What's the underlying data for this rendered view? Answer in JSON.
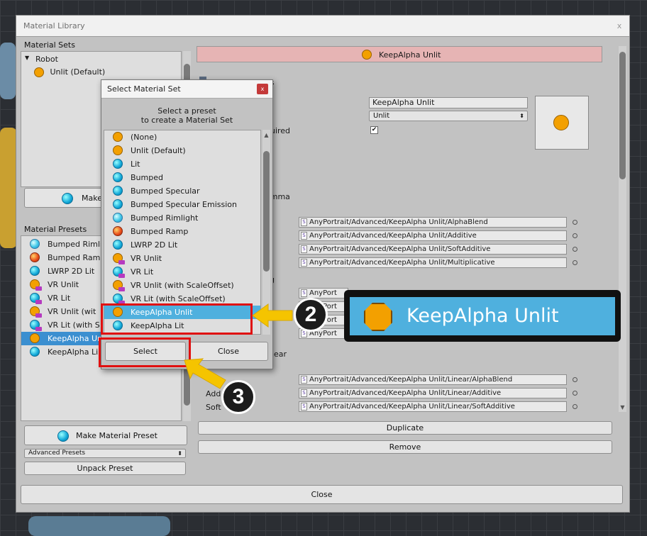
{
  "window": {
    "title": "Material Library",
    "close_glyph": "x"
  },
  "material_sets": {
    "heading": "Material Sets",
    "root": "Robot",
    "items": [
      {
        "label": "Unlit (Default)",
        "icon": "orange-circle-icon"
      }
    ],
    "make_button": "Make"
  },
  "material_presets": {
    "heading": "Material Presets",
    "items": [
      {
        "label": "Bumped Rimli",
        "icon": "rim-icon"
      },
      {
        "label": "Bumped Ramp",
        "icon": "ramp-icon"
      },
      {
        "label": "LWRP 2D Lit",
        "icon": "cyan-circle-icon"
      },
      {
        "label": "VR Unlit",
        "icon": "orange-vr-icon"
      },
      {
        "label": "VR Lit",
        "icon": "cyan-vr-icon"
      },
      {
        "label": "VR Unlit (wit",
        "icon": "orange-vr-icon"
      },
      {
        "label": "VR Lit (with S",
        "icon": "cyan-vr-icon"
      },
      {
        "label": "KeepAlpha Un",
        "icon": "orange-circle-icon",
        "selected": true
      },
      {
        "label": "KeepAlpha Li",
        "icon": "cyan-circle-icon"
      }
    ],
    "make_preset_button": "Make Material Preset",
    "advanced_dropdown": "Advanced Presets",
    "unpack_button": "Unpack Preset"
  },
  "right": {
    "header_title": "KeepAlpha Unlit",
    "partial_es": "es",
    "partial_quired": "quired",
    "partial_amma": "amma",
    "partial_g": "g",
    "partial_near": "near",
    "partial_add": "Add",
    "partial_soft": "Soft",
    "name_field": "KeepAlpha Unlit",
    "type_dropdown": "Unlit",
    "gamma_paths": [
      "AnyPortrait/Advanced/KeepAlpha Unlit/AlphaBlend",
      "AnyPortrait/Advanced/KeepAlpha Unlit/Additive",
      "AnyPortrait/Advanced/KeepAlpha Unlit/SoftAdditive",
      "AnyPortrait/Advanced/KeepAlpha Unlit/Multiplicative"
    ],
    "mid_paths_partial": [
      "AnyPort",
      "AnyPort",
      "AnyPort",
      "AnyPort"
    ],
    "linear_paths": [
      "AnyPortrait/Advanced/KeepAlpha Unlit/Linear/AlphaBlend",
      "AnyPortrait/Advanced/KeepAlpha Unlit/Linear/Additive",
      "AnyPortrait/Advanced/KeepAlpha Unlit/Linear/SoftAdditive"
    ],
    "duplicate_button": "Duplicate",
    "remove_button": "Remove"
  },
  "bottom_close": "Close",
  "dialog": {
    "title": "Select Material Set",
    "close_glyph": "x",
    "prompt_line1": "Select a preset",
    "prompt_line2": "to create a Material Set",
    "items": [
      {
        "label": "(None)",
        "icon": "orange"
      },
      {
        "label": "Unlit (Default)",
        "icon": "orange"
      },
      {
        "label": "Lit",
        "icon": "cyan"
      },
      {
        "label": "Bumped",
        "icon": "cyan"
      },
      {
        "label": "Bumped Specular",
        "icon": "cyan"
      },
      {
        "label": "Bumped Specular Emission",
        "icon": "cyan"
      },
      {
        "label": "Bumped Rimlight",
        "icon": "rim"
      },
      {
        "label": "Bumped Ramp",
        "icon": "ramp"
      },
      {
        "label": "LWRP 2D Lit",
        "icon": "cyan"
      },
      {
        "label": "VR Unlit",
        "icon": "orange-vr"
      },
      {
        "label": "VR Lit",
        "icon": "cyan-vr"
      },
      {
        "label": "VR Unlit (with ScaleOffset)",
        "icon": "orange-vr"
      },
      {
        "label": "VR Lit (with ScaleOffset)",
        "icon": "cyan-vr"
      },
      {
        "label": "KeepAlpha Unlit",
        "icon": "orange",
        "selected": true
      },
      {
        "label": "KeepAlpha Lit",
        "icon": "cyan"
      }
    ],
    "select_button": "Select",
    "close_button": "Close"
  },
  "callouts": {
    "step2": "2",
    "step3": "3",
    "zoom_label": "KeepAlpha Unlit",
    "accent_color": "#f5c400",
    "highlight_color": "#e01010"
  }
}
